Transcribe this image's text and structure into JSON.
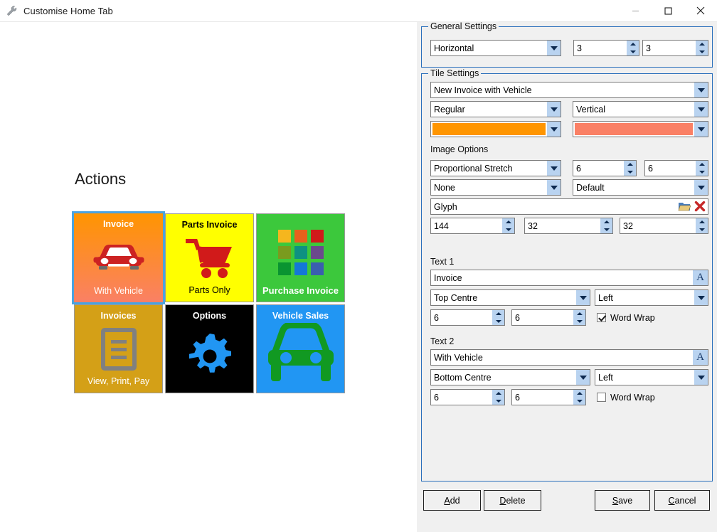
{
  "window": {
    "title": "Customise Home Tab",
    "icon": "wrench-icon",
    "minimize": "minimize",
    "maximize": "maximize",
    "close": "close"
  },
  "preview": {
    "section_title": "Actions",
    "tiles": [
      {
        "caption_top": "Invoice",
        "caption_bottom": "With Vehicle",
        "glyph": "car-icon",
        "selected": true,
        "bg_start": "#FF9500",
        "bg_end": "#FA8065",
        "text_color": "#FFFFFF",
        "glyph_color": "#CC2222"
      },
      {
        "caption_top": "Parts Invoice",
        "caption_bottom": "Parts Only",
        "glyph": "shopping-cart-icon",
        "selected": false,
        "bg_start": "#FFFF00",
        "bg_end": "#FFFF00",
        "text_color": "#000000",
        "glyph_color": "#D11A1A"
      },
      {
        "caption_top": "",
        "caption_bottom": "Purchase Invoice",
        "glyph": "color-grid-icon",
        "selected": false,
        "bg_start": "#3CC83C",
        "bg_end": "#3CC83C",
        "text_color": "#FFFFFF",
        "glyph_color": "#FFFFFF"
      },
      {
        "caption_top": "Invoices",
        "caption_bottom": "View, Print, Pay",
        "glyph": "document-icon",
        "selected": false,
        "bg_start": "#D4A017",
        "bg_end": "#D4A017",
        "text_color": "#FFFFFF",
        "glyph_color": "#808080"
      },
      {
        "caption_top": "Options",
        "caption_bottom": "",
        "glyph": "gear-icon",
        "selected": false,
        "bg_start": "#000000",
        "bg_end": "#000000",
        "text_color": "#FFFFFF",
        "glyph_color": "#2196F3"
      },
      {
        "caption_top": "Vehicle Sales",
        "caption_bottom": "",
        "glyph": "car-front-icon",
        "selected": false,
        "bg_start": "#2196F3",
        "bg_end": "#2196F3",
        "text_color": "#FFFFFF",
        "glyph_color": "#119922"
      }
    ],
    "grid_colors": [
      "#F5B61E",
      "#E8601C",
      "#D01A1A",
      "#7A9B1E",
      "#0E9182",
      "#6B4A8C",
      "#0A9431",
      "#1478D6",
      "#3A5FAE"
    ]
  },
  "general_settings": {
    "legend": "General Settings",
    "orientation": "Horizontal",
    "columns": "3",
    "rows": "3"
  },
  "tile_settings": {
    "legend": "Tile Settings",
    "tile_name": "New Invoice with Vehicle",
    "size": "Regular",
    "gradient_direction": "Vertical",
    "color_start": "#FF9500",
    "color_end": "#FA8065",
    "image_options": {
      "label": "Image Options",
      "stretch_mode": "Proportional Stretch",
      "margin_x": "6",
      "margin_y": "6",
      "effect": "None",
      "quality": "Default",
      "source": "Glyph",
      "browse_icon": "folder-open-icon",
      "clear_icon": "delete-red-x-icon",
      "glyph_index": "144",
      "glyph_width": "32",
      "glyph_height": "32"
    },
    "text1": {
      "label": "Text 1",
      "value": "Invoice",
      "font_button": "font-icon",
      "position": "Top Centre",
      "alignment": "Left",
      "offset_x": "6",
      "offset_y": "6",
      "word_wrap_label": "Word Wrap",
      "word_wrap": true
    },
    "text2": {
      "label": "Text 2",
      "value": "With Vehicle",
      "font_button": "font-icon",
      "position": "Bottom Centre",
      "alignment": "Left",
      "offset_x": "6",
      "offset_y": "6",
      "word_wrap_label": "Word Wrap",
      "word_wrap": false
    }
  },
  "footer": {
    "add": "Add",
    "delete": "Delete",
    "save": "Save",
    "cancel": "Cancel",
    "add_accel": "A",
    "delete_accel": "D",
    "save_accel": "S",
    "cancel_accel": "C"
  }
}
